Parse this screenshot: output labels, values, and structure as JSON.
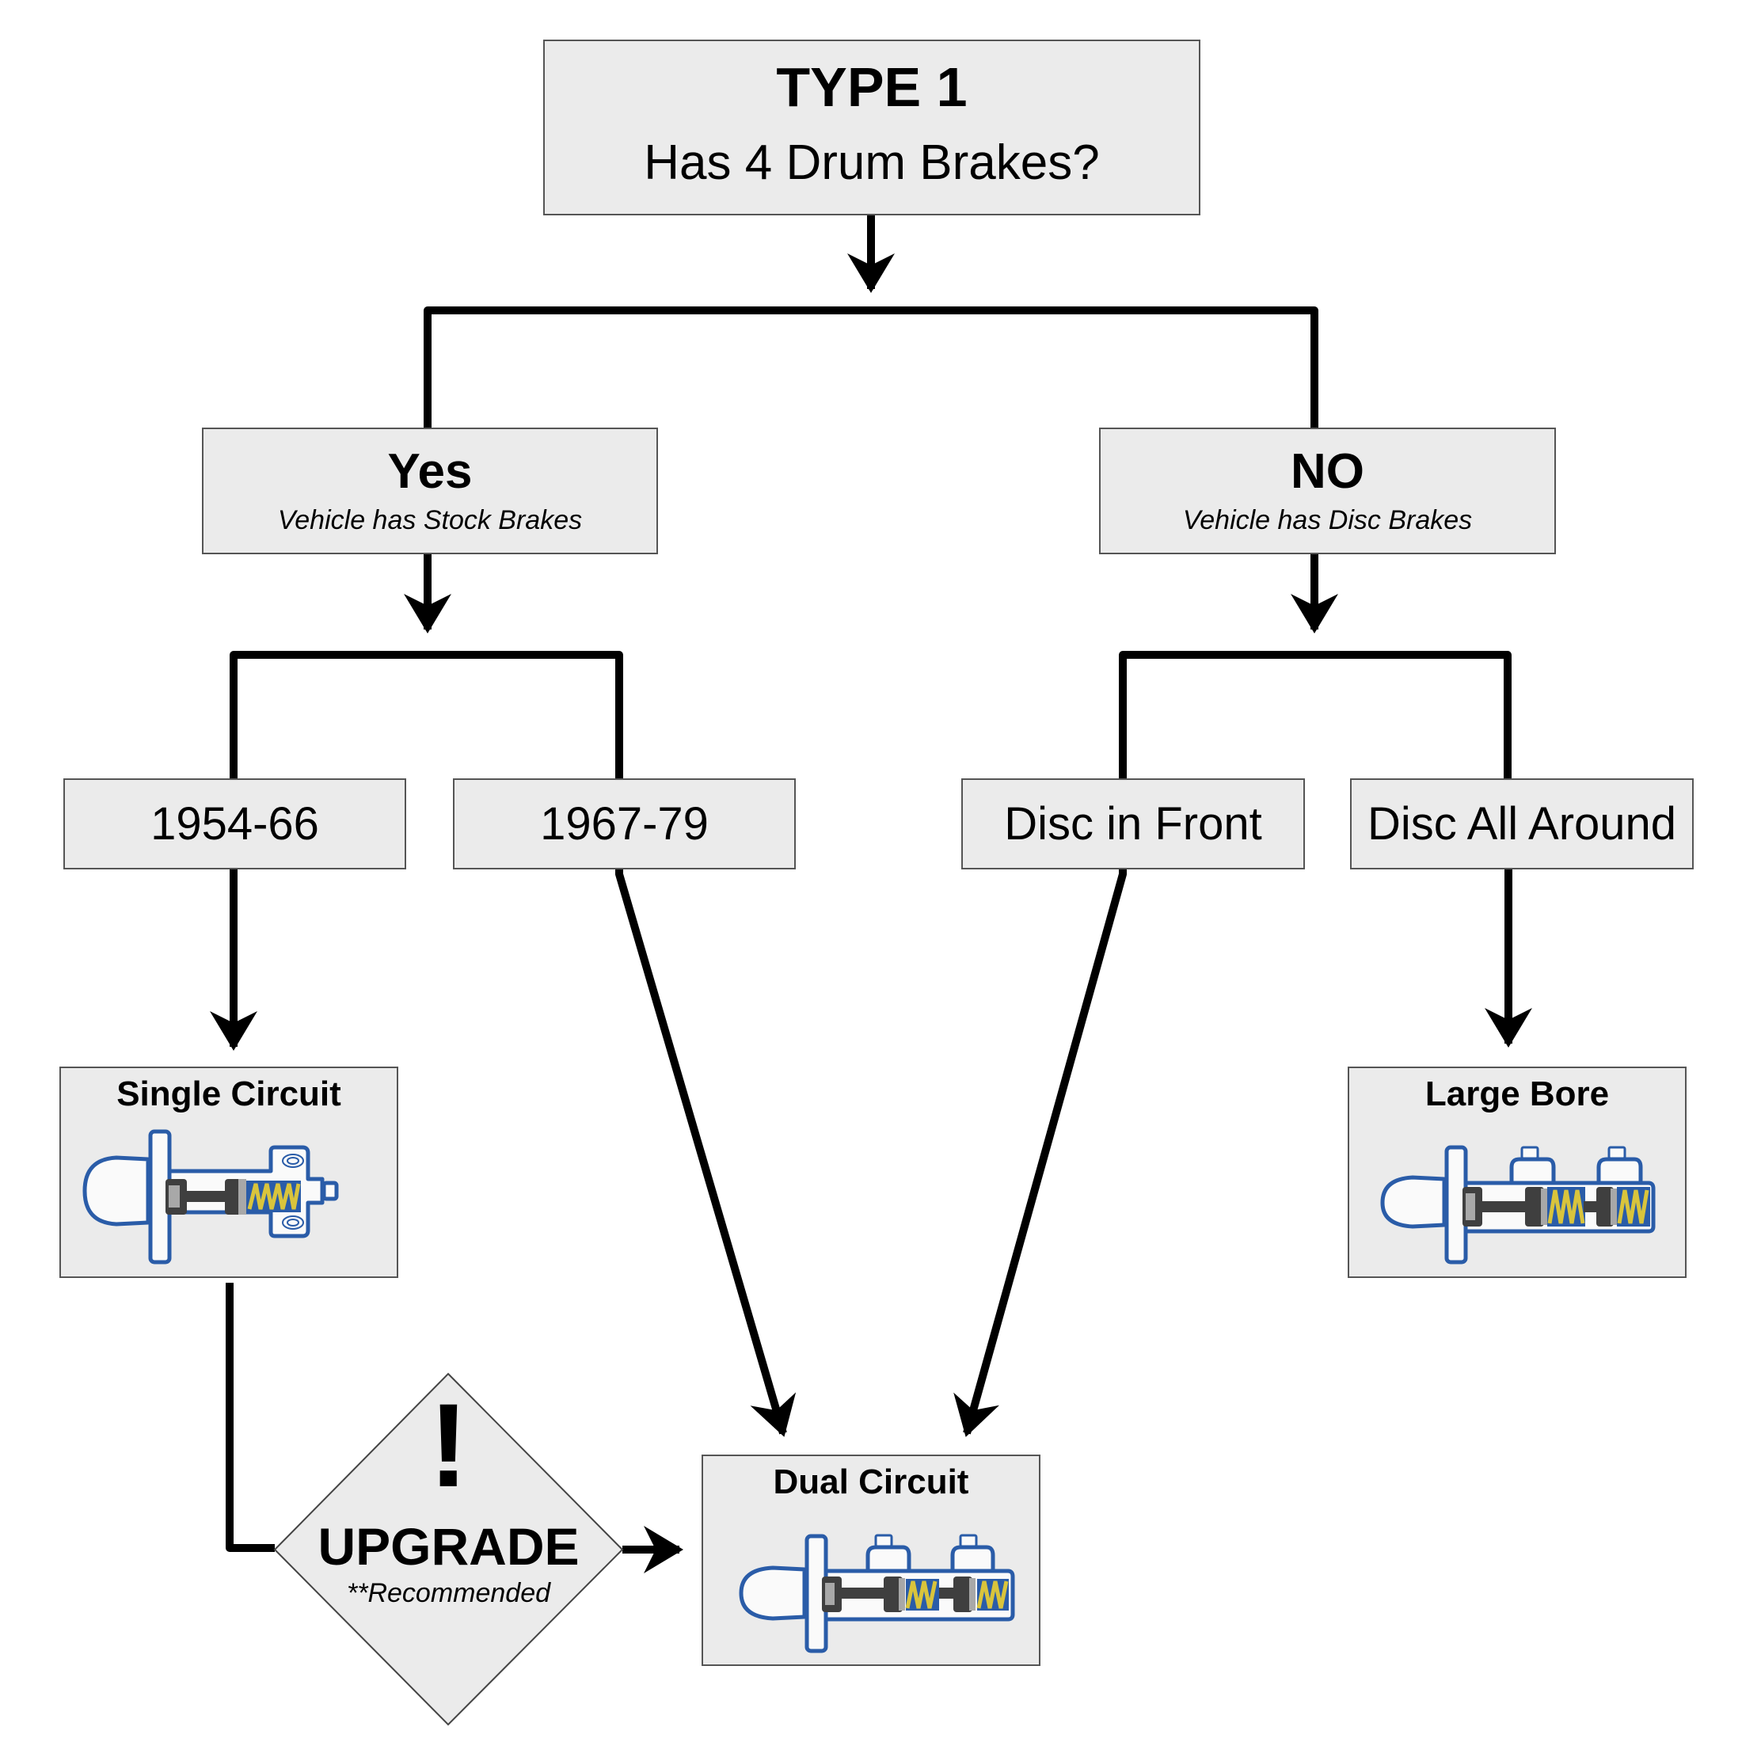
{
  "diagram": {
    "root": {
      "title": "TYPE 1",
      "question": "Has 4 Drum Brakes?"
    },
    "branches": {
      "yes": {
        "title": "Yes",
        "subtitle": "Vehicle has Stock Brakes"
      },
      "no": {
        "title": "NO",
        "subtitle": "Vehicle has Disc Brakes"
      }
    },
    "options": {
      "y1954": "1954-66",
      "y1967": "1967-79",
      "disc_front": "Disc in Front",
      "disc_all": "Disc All Around"
    },
    "results": {
      "single": "Single Circuit",
      "dual": "Dual Circuit",
      "large": "Large Bore"
    },
    "upgrade": {
      "icon": "!",
      "title": "UPGRADE",
      "note": "**Recommended"
    },
    "colors": {
      "box_fill": "#ebebeb",
      "line": "#000000",
      "cylinder_outline": "#2a5ca8",
      "spring": "#d9c43c",
      "piston_dark": "#3f3f3f",
      "piston_light": "#a8a8a8"
    }
  }
}
